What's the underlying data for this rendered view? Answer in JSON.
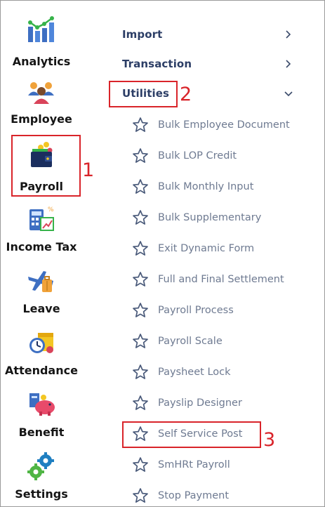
{
  "modules": [
    {
      "key": "analytics",
      "label": "Analytics",
      "icon": "analytics-chart-icon"
    },
    {
      "key": "employee",
      "label": "Employee",
      "icon": "people-group-icon"
    },
    {
      "key": "payroll",
      "label": "Payroll",
      "icon": "wallet-icon",
      "selected": true
    },
    {
      "key": "income-tax",
      "label": "Income Tax",
      "icon": "tax-calculator-icon"
    },
    {
      "key": "leave",
      "label": "Leave",
      "icon": "airplane-luggage-icon"
    },
    {
      "key": "attendance",
      "label": "Attendance",
      "icon": "attendance-clock-icon"
    },
    {
      "key": "benefit",
      "label": "Benefit",
      "icon": "piggy-bank-icon"
    },
    {
      "key": "settings",
      "label": "Settings",
      "icon": "gears-icon"
    }
  ],
  "menu": {
    "groups": [
      {
        "label": "Import",
        "state": "collapsed",
        "chevron": "chevron-right-icon"
      },
      {
        "label": "Transaction",
        "state": "collapsed",
        "chevron": "chevron-right-icon"
      },
      {
        "label": "Utilities",
        "state": "expanded",
        "chevron": "chevron-down-icon"
      }
    ],
    "utilities_items": [
      {
        "label": "Bulk Employee Document"
      },
      {
        "label": "Bulk LOP Credit"
      },
      {
        "label": "Bulk Monthly Input"
      },
      {
        "label": "Bulk Supplementary"
      },
      {
        "label": "Exit Dynamic Form"
      },
      {
        "label": "Full and Final Settlement"
      },
      {
        "label": "Payroll Process"
      },
      {
        "label": "Payroll Scale"
      },
      {
        "label": "Paysheet Lock"
      },
      {
        "label": "Payslip Designer"
      },
      {
        "label": "Self Service Post"
      },
      {
        "label": "SmHRt Payroll"
      },
      {
        "label": "Stop Payment"
      }
    ]
  },
  "annotations": {
    "step1": "1",
    "step2": "2",
    "step3": "3"
  },
  "colors": {
    "highlight": "#d9242a",
    "group_text": "#2c3e66",
    "item_text": "#6e7a91",
    "star": "#4a5a7a"
  }
}
